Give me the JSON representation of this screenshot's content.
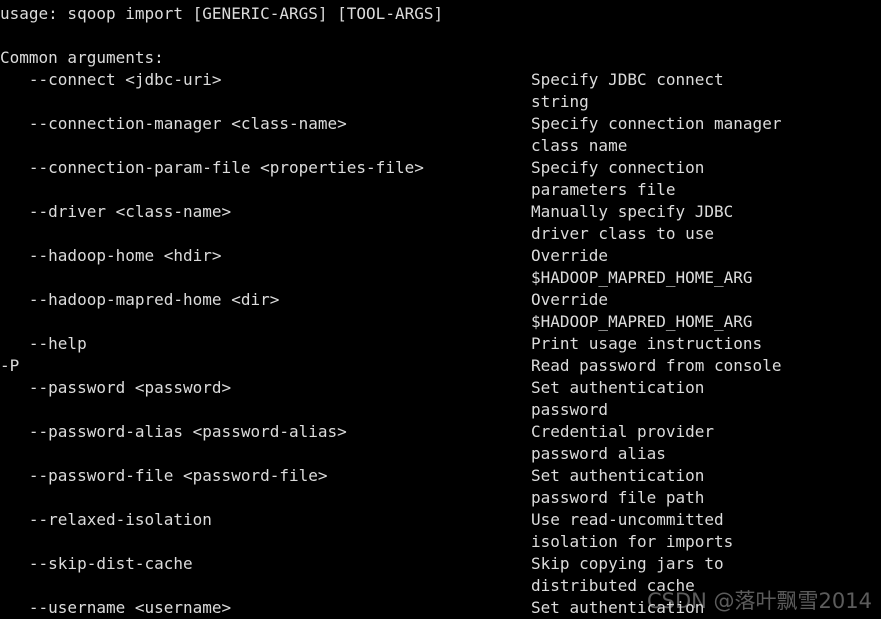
{
  "terminal": {
    "colors": {
      "background": "#000000",
      "foreground": "#dcdcdc",
      "watermark": "rgba(200,200,200,0.46)"
    },
    "usage_line": "usage: sqoop import [GENERIC-ARGS] [TOOL-ARGS]",
    "blank_line": "",
    "section_heading": "Common arguments:",
    "lines": [
      {
        "option": "   --connect <jdbc-uri>",
        "description": "Specify JDBC connect"
      },
      {
        "option": "",
        "description": "string"
      },
      {
        "option": "   --connection-manager <class-name>",
        "description": "Specify connection manager"
      },
      {
        "option": "",
        "description": "class name"
      },
      {
        "option": "   --connection-param-file <properties-file>",
        "description": "Specify connection"
      },
      {
        "option": "",
        "description": "parameters file"
      },
      {
        "option": "   --driver <class-name>",
        "description": "Manually specify JDBC"
      },
      {
        "option": "",
        "description": "driver class to use"
      },
      {
        "option": "   --hadoop-home <hdir>",
        "description": "Override"
      },
      {
        "option": "",
        "description": "$HADOOP_MAPRED_HOME_ARG"
      },
      {
        "option": "   --hadoop-mapred-home <dir>",
        "description": "Override"
      },
      {
        "option": "",
        "description": "$HADOOP_MAPRED_HOME_ARG"
      },
      {
        "option": "   --help",
        "description": "Print usage instructions"
      },
      {
        "option": "-P",
        "description": "Read password from console"
      },
      {
        "option": "   --password <password>",
        "description": "Set authentication"
      },
      {
        "option": "",
        "description": "password"
      },
      {
        "option": "   --password-alias <password-alias>",
        "description": "Credential provider"
      },
      {
        "option": "",
        "description": "password alias"
      },
      {
        "option": "   --password-file <password-file>",
        "description": "Set authentication"
      },
      {
        "option": "",
        "description": "password file path"
      },
      {
        "option": "   --relaxed-isolation",
        "description": "Use read-uncommitted"
      },
      {
        "option": "",
        "description": "isolation for imports"
      },
      {
        "option": "   --skip-dist-cache",
        "description": "Skip copying jars to"
      },
      {
        "option": "",
        "description": "distributed cache"
      },
      {
        "option": "   --username <username>",
        "description": "Set authentication"
      }
    ]
  },
  "watermark": {
    "text": "CSDN @落叶飘雪2014"
  }
}
